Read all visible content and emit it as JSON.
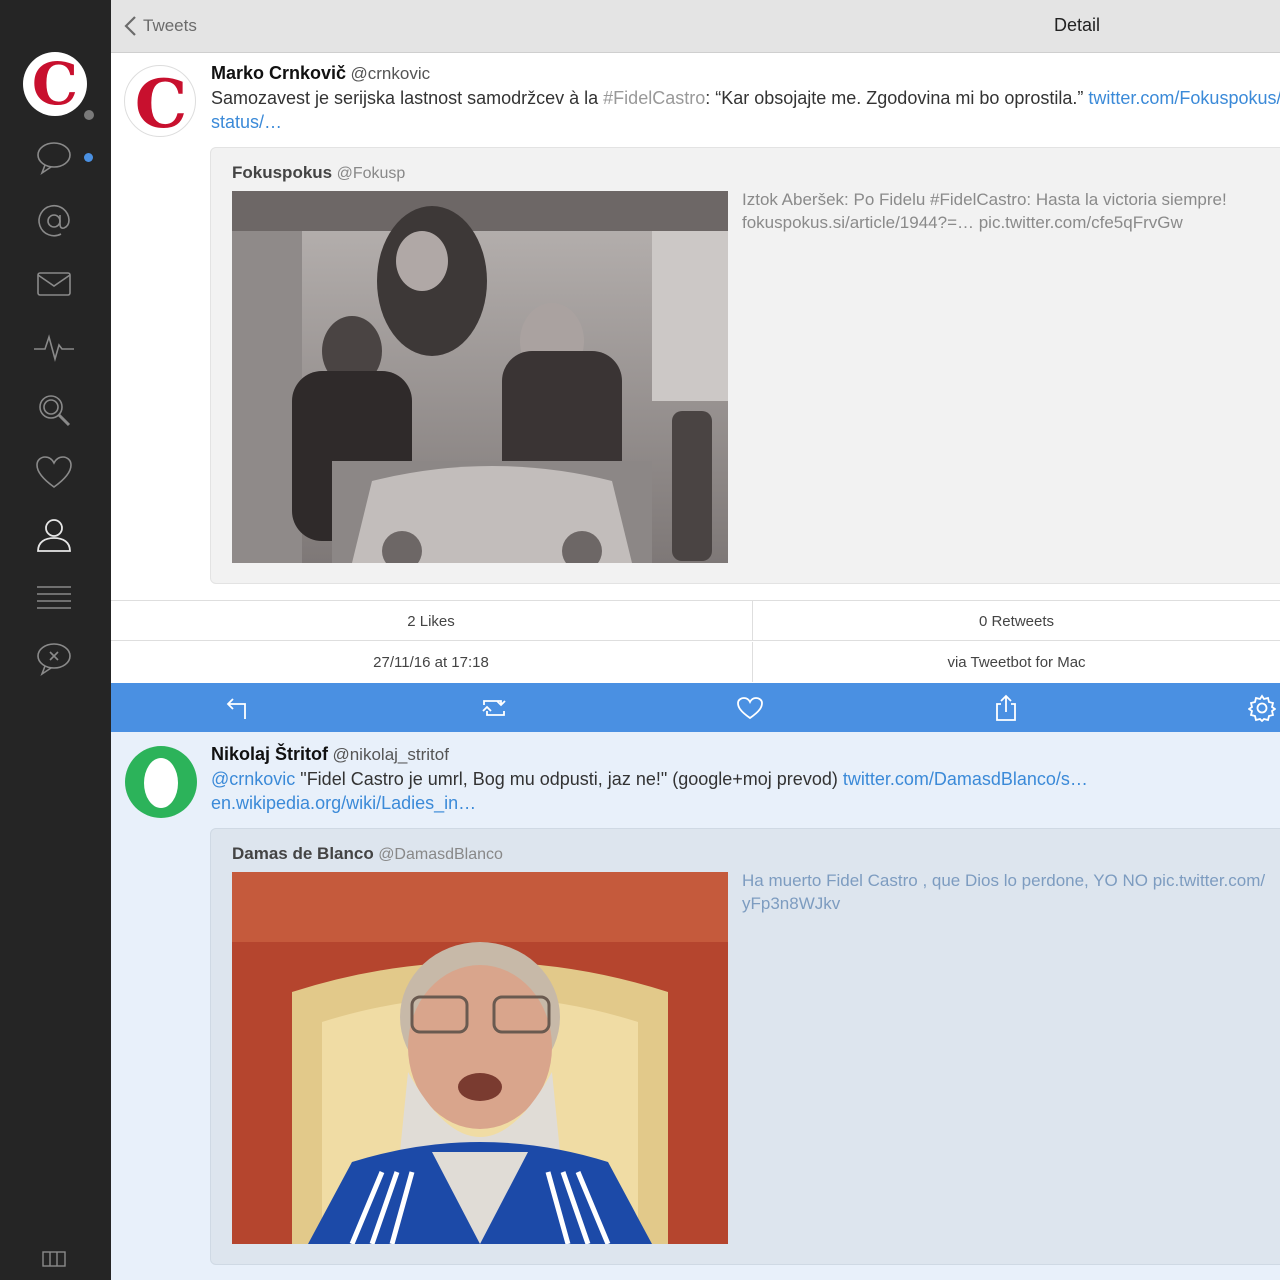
{
  "topbar": {
    "back_label": "Tweets",
    "title": "Detail"
  },
  "sidebar": {
    "items": [
      {
        "name": "timeline",
        "icon": "speech-bubble-icon"
      },
      {
        "name": "mentions",
        "icon": "at-icon"
      },
      {
        "name": "messages",
        "icon": "envelope-icon"
      },
      {
        "name": "activity",
        "icon": "pulse-icon"
      },
      {
        "name": "search",
        "icon": "search-icon"
      },
      {
        "name": "favorites",
        "icon": "heart-icon"
      },
      {
        "name": "profile",
        "icon": "person-icon"
      },
      {
        "name": "lists",
        "icon": "list-icon"
      },
      {
        "name": "mute",
        "icon": "muted-bubble-icon"
      }
    ],
    "footer_icon": "columns-icon",
    "unread_color": "#4a90e2"
  },
  "tweet1": {
    "name": "Marko Crnkovič",
    "handle": "@crnkovic",
    "text_before": "Samozavest je serijska lastnost samodržcev à la ",
    "hashtag": "#FidelCastro",
    "text_after": ": “Kar obsojajte me. Zgodovina mi bo oprostila.” ",
    "link1": "twitter.com/Fokuspokus/",
    "link2": "status/…",
    "avatar_letter": "C",
    "quote": {
      "name": "Fokuspokus",
      "handle": "@Fokusp",
      "line1": "Iztok Aberšek: Po Fidelu #FidelCastro: Hasta la victoria siempre!",
      "line2": "fokuspokus.si/article/1944?=…  pic.twitter.com/cfe5qFrvGw"
    },
    "likes": "2 Likes",
    "retweets": "0 Retweets",
    "date": "27/11/16 at 17:18",
    "via": "via Tweetbot for Mac"
  },
  "actions": [
    {
      "name": "reply",
      "icon": "reply-icon"
    },
    {
      "name": "retweet",
      "icon": "retweet-icon"
    },
    {
      "name": "like",
      "icon": "heart-icon"
    },
    {
      "name": "share",
      "icon": "share-icon"
    },
    {
      "name": "settings",
      "icon": "gear-icon"
    }
  ],
  "tweet2": {
    "name": "Nikolaj Štritof",
    "handle": "@nikolaj_stritof",
    "mention": "@crnkovic",
    "text": "   \"Fidel Castro je umrl, Bog mu odpusti, jaz ne!\" (google+moj prevod) ",
    "link1": "twitter.com/DamasdBlanco/s…",
    "link2": "en.wikipedia.org/wiki/Ladies_in…",
    "quote": {
      "name": "Damas de Blanco",
      "handle": "@DamasdBlanco",
      "line1": "Ha muerto Fidel Castro , que Dios lo perdone, YO NO pic.twitter.com/",
      "line2": "yFp3n8WJkv"
    }
  },
  "colors": {
    "accent": "#4a90e2",
    "sidebar": "#252525",
    "link": "#3b8ad8",
    "avatar_green": "#2cb35a",
    "brand_red": "#c8102e"
  }
}
